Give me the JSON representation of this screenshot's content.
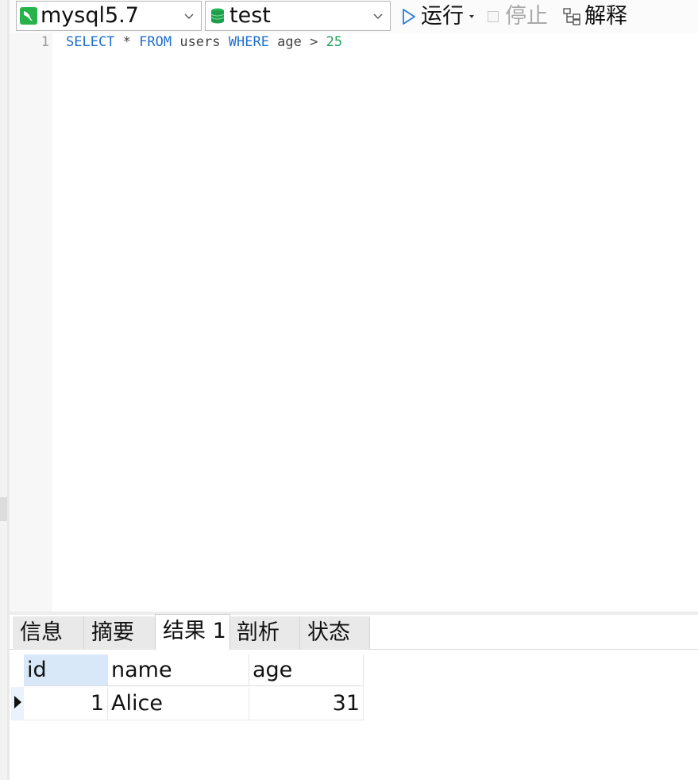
{
  "toolbar": {
    "connection": "mysql5.7",
    "database": "test",
    "run_label": "运行",
    "stop_label": "停止",
    "explain_label": "解释"
  },
  "editor": {
    "line_number": "1",
    "tokens": {
      "select": "SELECT",
      "star": " * ",
      "from": "FROM",
      "table": " users ",
      "where": "WHERE",
      "cond": " age > ",
      "value": "25"
    }
  },
  "result_tabs": [
    {
      "label": "信息"
    },
    {
      "label": "摘要"
    },
    {
      "label": "结果 1"
    },
    {
      "label": "剖析"
    },
    {
      "label": "状态"
    }
  ],
  "grid": {
    "columns": [
      "id",
      "name",
      "age"
    ],
    "rows": [
      {
        "id": "1",
        "name": "Alice",
        "age": "31"
      }
    ]
  },
  "colors": {
    "keyword": "#1f6fd1",
    "number": "#21a35a",
    "selected_header": "#d8e8f8",
    "mysql_icon": "#27b24a",
    "db_icon": "#1e9e4a",
    "run_icon": "#2a7de1"
  },
  "icons": {
    "connection": "mysql-dolphin-icon",
    "database": "database-cylinder-icon",
    "run": "play-triangle-icon",
    "stop": "stop-square-icon",
    "explain": "explain-tree-icon"
  }
}
